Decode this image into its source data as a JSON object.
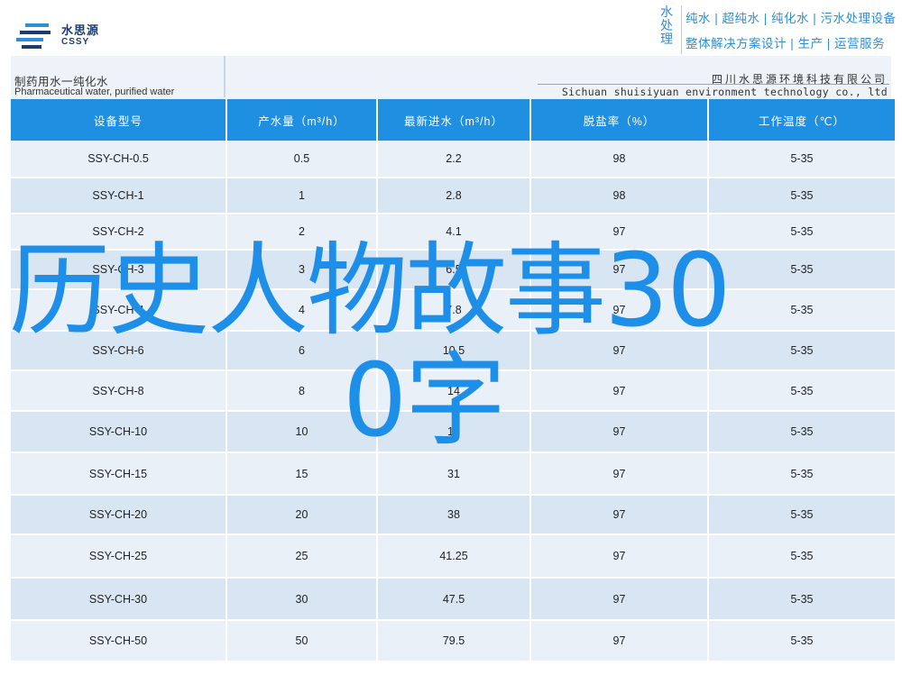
{
  "logo": {
    "cn": "水思源",
    "en": "CSSY"
  },
  "brand_panel": {
    "vertical_label": [
      "水",
      "处",
      "理"
    ],
    "line1": "纯水 | 超纯水 | 纯化水 | 污水处理设备",
    "line2": "整体解决方案设计 | 生产 | 运营服务"
  },
  "title": {
    "cn": "制药用水一纯化水",
    "en": "Pharmaceutical water, purified water",
    "company_cn": "四川水思源环境科技有限公司",
    "company_en": "Sichuan shuisiyuan environment technology co., ltd"
  },
  "table": {
    "headers": [
      "设备型号",
      "产水量（m³/h）",
      "最新进水（m³/h）",
      "脱盐率（%）",
      "工作温度（℃）"
    ],
    "rows": [
      [
        "SSY-CH-0.5",
        "0.5",
        "2.2",
        "98",
        "5-35"
      ],
      [
        "SSY-CH-1",
        "1",
        "2.8",
        "98",
        "5-35"
      ],
      [
        "SSY-CH-2",
        "2",
        "4.1",
        "97",
        "5-35"
      ],
      [
        "SSY-CH-3",
        "3",
        "6.5",
        "97",
        "5-35"
      ],
      [
        "SSY-CH-4",
        "4",
        "7.8",
        "97",
        "5-35"
      ],
      [
        "SSY-CH-6",
        "6",
        "10.5",
        "97",
        "5-35"
      ],
      [
        "SSY-CH-8",
        "8",
        "14",
        "97",
        "5-35"
      ],
      [
        "SSY-CH-10",
        "10",
        "17",
        "97",
        "5-35"
      ],
      [
        "SSY-CH-15",
        "15",
        "31",
        "97",
        "5-35"
      ],
      [
        "SSY-CH-20",
        "20",
        "38",
        "97",
        "5-35"
      ],
      [
        "SSY-CH-25",
        "25",
        "41.25",
        "97",
        "5-35"
      ],
      [
        "SSY-CH-30",
        "30",
        "47.5",
        "97",
        "5-35"
      ],
      [
        "SSY-CH-50",
        "50",
        "79.5",
        "97",
        "5-35"
      ]
    ]
  },
  "overlay": {
    "line1": "历史人物故事30",
    "line2": "0字"
  },
  "colors": {
    "header_blue": "#1f8fe2",
    "accent_blue": "#2e8fd4",
    "overlay_blue": "#1e8fe8",
    "row_light": "#e9f0f8",
    "row_dark": "#d8e5f3"
  }
}
